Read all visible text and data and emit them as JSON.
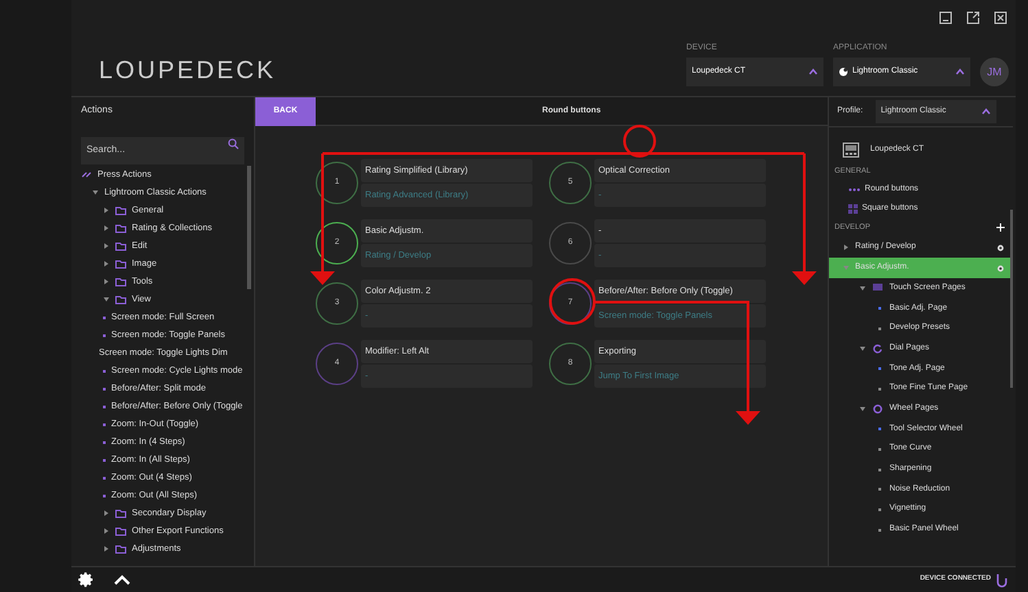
{
  "app": {
    "logo": "LOUPEDECK",
    "user_initials": "JM"
  },
  "device": {
    "label": "DEVICE",
    "value": "Loupedeck CT"
  },
  "application": {
    "label": "APPLICATION",
    "value": "Lightroom Classic"
  },
  "actions": {
    "title": "Actions",
    "search_placeholder": "Search...",
    "tree": [
      {
        "label": "Press Actions",
        "kind": "root"
      },
      {
        "label": "Lightroom Classic Actions",
        "kind": "group",
        "expanded": true,
        "children": [
          {
            "label": "General",
            "kind": "folder",
            "expanded": false
          },
          {
            "label": "Rating & Collections",
            "kind": "folder",
            "expanded": false
          },
          {
            "label": "Edit",
            "kind": "folder",
            "expanded": false
          },
          {
            "label": "Image",
            "kind": "folder",
            "expanded": false
          },
          {
            "label": "Tools",
            "kind": "folder",
            "expanded": false
          },
          {
            "label": "View",
            "kind": "folder",
            "expanded": true,
            "children": [
              {
                "label": "Screen mode: Full Screen",
                "kind": "action",
                "dragged": false
              },
              {
                "label": "Screen mode: Toggle Panels",
                "kind": "action",
                "dragged": false
              },
              {
                "label": "Screen mode: Toggle Lights Dim",
                "kind": "action",
                "dragged": true
              },
              {
                "label": "Screen mode: Cycle Lights mode",
                "kind": "action",
                "dragged": false
              },
              {
                "label": "Before/After: Split mode",
                "kind": "action",
                "dragged": false
              },
              {
                "label": "Before/After: Before Only (Toggle",
                "kind": "action",
                "dragged": false
              },
              {
                "label": "Zoom: In-Out (Toggle)",
                "kind": "action",
                "dragged": false
              },
              {
                "label": "Zoom: In (4 Steps)",
                "kind": "action",
                "dragged": false
              },
              {
                "label": "Zoom: In (All Steps)",
                "kind": "action",
                "dragged": false
              },
              {
                "label": "Zoom: Out (4 Steps)",
                "kind": "action",
                "dragged": false
              },
              {
                "label": "Zoom: Out (All Steps)",
                "kind": "action",
                "dragged": false
              }
            ]
          },
          {
            "label": "Secondary Display",
            "kind": "folder",
            "expanded": false
          },
          {
            "label": "Other Export Functions",
            "kind": "folder",
            "expanded": false
          },
          {
            "label": "Adjustments",
            "kind": "folder",
            "expanded": false
          }
        ]
      }
    ]
  },
  "editor": {
    "back": "BACK",
    "title": "Round buttons",
    "buttons": [
      {
        "number": "1",
        "color": "#3f6e45",
        "press": "Rating Simplified (Library)",
        "second": "Rating Advanced (Library)"
      },
      {
        "number": "2",
        "color": "#4caf50",
        "press": "Basic Adjustm.",
        "second": "Rating / Develop"
      },
      {
        "number": "3",
        "color": "#3f6e45",
        "press": "Color Adjustm. 2",
        "second": "-"
      },
      {
        "number": "4",
        "color": "#5b3f86",
        "press": "Modifier: Left Alt",
        "second": "-"
      },
      {
        "number": "5",
        "color": "#3f6e45",
        "press": "Optical Correction",
        "second": "-"
      },
      {
        "number": "6",
        "color": "#4a4a4a",
        "press": "-",
        "second": "-"
      },
      {
        "number": "7",
        "color": "#5b3f86",
        "press": "Before/After: Before Only (Toggle)",
        "second": "Screen mode: Toggle Panels"
      },
      {
        "number": "8",
        "color": "#3f6e45",
        "press": "Exporting",
        "second": "Jump To First Image"
      }
    ]
  },
  "profile": {
    "label": "Profile:",
    "value": "Lightroom Classic",
    "device": "Loupedeck CT",
    "general_heading": "GENERAL",
    "general": [
      {
        "label": "Round buttons",
        "kind": "round"
      },
      {
        "label": "Square buttons",
        "kind": "square"
      }
    ],
    "develop_heading": "DEVELOP",
    "develop": [
      {
        "label": "Rating / Develop",
        "selected": false,
        "expanded": false
      },
      {
        "label": "Basic Adjustm.",
        "selected": true,
        "expanded": true,
        "children": [
          {
            "label": "Touch Screen Pages",
            "kind": "touch",
            "expanded": true,
            "children": [
              {
                "label": "Basic Adj. Page",
                "active": true
              },
              {
                "label": "Develop Presets",
                "active": false
              }
            ]
          },
          {
            "label": "Dial Pages",
            "kind": "dial",
            "expanded": true,
            "children": [
              {
                "label": "Tone Adj. Page",
                "active": true
              },
              {
                "label": "Tone Fine Tune Page",
                "active": false
              }
            ]
          },
          {
            "label": "Wheel Pages",
            "kind": "wheel",
            "expanded": true,
            "children": [
              {
                "label": "Tool Selector Wheel",
                "active": true
              },
              {
                "label": "Tone Curve",
                "active": false
              },
              {
                "label": "Sharpening",
                "active": false
              },
              {
                "label": "Noise Reduction",
                "active": false
              },
              {
                "label": "Vignetting",
                "active": false
              },
              {
                "label": "Basic Panel Wheel",
                "active": false
              }
            ]
          }
        ]
      }
    ]
  },
  "status": {
    "text": "DEVICE CONNECTED"
  }
}
